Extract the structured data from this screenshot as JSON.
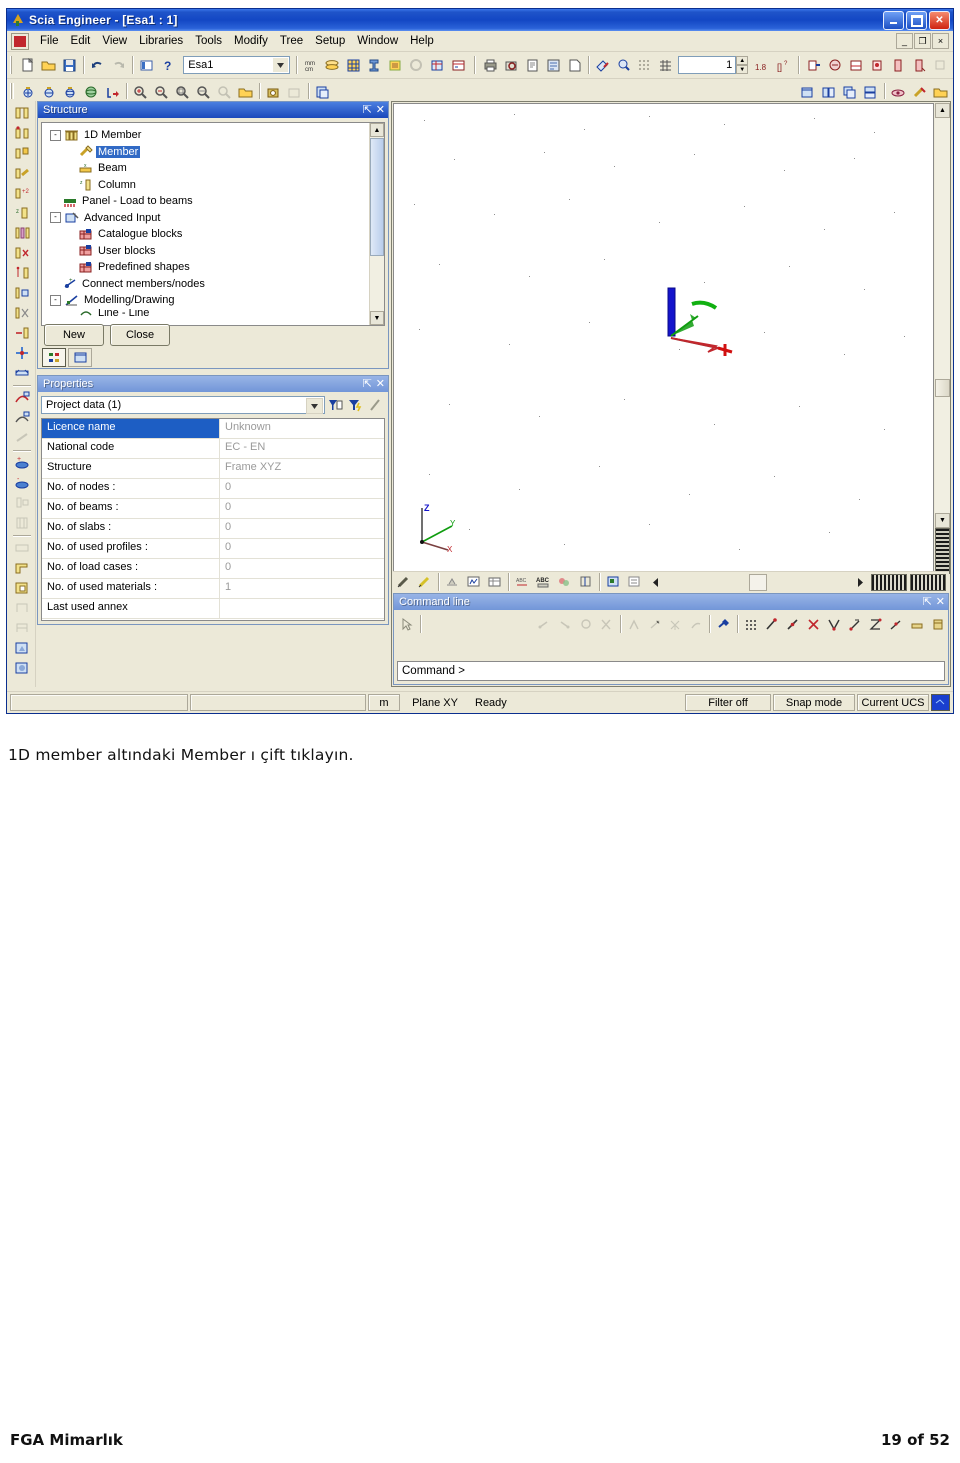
{
  "window": {
    "title": "Scia Engineer - [Esa1 : 1]",
    "app_icon": "scia-logo-icon",
    "buttons": {
      "minimize": "minimize-icon",
      "maximize": "maximize-icon",
      "close": "close-icon"
    },
    "mdi_buttons": {
      "minimize": "_",
      "restore": "❐",
      "close": "×"
    }
  },
  "menubar": {
    "items": [
      {
        "label": "File",
        "accel": "F"
      },
      {
        "label": "Edit",
        "accel": "E"
      },
      {
        "label": "View",
        "accel": "V"
      },
      {
        "label": "Libraries",
        "accel": "L"
      },
      {
        "label": "Tools",
        "accel": "T"
      },
      {
        "label": "Modify",
        "accel": "M"
      },
      {
        "label": "Tree",
        "accel": "r"
      },
      {
        "label": "Setup",
        "accel": "S"
      },
      {
        "label": "Window",
        "accel": "W"
      },
      {
        "label": "Help",
        "accel": "H"
      }
    ]
  },
  "toolbar": {
    "project_combo_value": "Esa1",
    "layer_spin_value": "1",
    "icons_row1_left": [
      "new-document-icon",
      "open-folder-icon",
      "save-disk-icon",
      "undo-icon",
      "redo-icon",
      "project-data-icon",
      "help-question-icon"
    ],
    "icons_row1_mid": [
      "units-mmcm-icon",
      "layers-icon",
      "grid-setup-icon",
      "cross-section-icon",
      "materials-icon",
      "loads-disabled-icon",
      "structure-icon",
      "calculation-icon"
    ],
    "icons_row1_right": [
      "print-icon",
      "print-preview-icon",
      "document-icon",
      "report-icon",
      "page-icon",
      "paint-icon",
      "zoom-selection-icon",
      "dot-grid-icon",
      "line-grid-icon",
      "decimals-icon",
      "units-query-icon",
      "result-1-icon",
      "result-2-icon",
      "result-3-icon",
      "result-4-icon",
      "result-5-icon",
      "result-6-icon",
      "result-7-disabled-icon"
    ],
    "icons_row2_left": [
      "view-front-icon",
      "view-side-icon",
      "view-top-icon",
      "view-3d-icon",
      "render-icon",
      "zoom-in-icon",
      "zoom-out-icon",
      "zoom-window-icon",
      "zoom-all-icon",
      "zoom-prev-disabled-icon",
      "open-view-icon",
      "camera-icon",
      "camera-disabled-icon",
      "copy-view-icon"
    ],
    "icons_row2_right": [
      "window-new-icon",
      "window-tile-icon",
      "window-cascade-icon",
      "window-arrange-icon",
      "eye-visibility-icon",
      "clean-icon",
      "folder-open-icon"
    ]
  },
  "vertical_toolbar": {
    "icons": [
      "member-1-icon",
      "member-2-icon",
      "member-3-icon",
      "member-4-icon",
      "member-5-icon",
      "column-icon",
      "multi-member-icon",
      "cut-member-icon",
      "split-member-icon",
      "align-member-icon",
      "trim-member-icon",
      "extend-member-icon",
      "join-member-icon",
      "mirror-member-icon",
      "arc-node-icon",
      "node-support-icon",
      "hinge-disabled-icon",
      "add-node-icon",
      "remove-node-icon",
      "support-disabled-icon",
      "building-disabled-icon",
      "slab-disabled-icon",
      "plane-icon",
      "plane-opening-icon",
      "wall-disabled-icon",
      "wall2-disabled-icon",
      "surface-load-icon",
      "surface-load-2-icon"
    ]
  },
  "structure_panel": {
    "title": "Structure",
    "pin_icon": "pin-icon",
    "close_icon": "close-icon",
    "tree": [
      {
        "label": "1D Member",
        "level": 0,
        "expander": "-",
        "icon": "1d-member-icon",
        "selected": false
      },
      {
        "label": "Member",
        "level": 1,
        "expander": "",
        "icon": "member-icon",
        "selected": true
      },
      {
        "label": "Beam",
        "level": 1,
        "expander": "",
        "icon": "beam-icon",
        "selected": false
      },
      {
        "label": "Column",
        "level": 1,
        "expander": "",
        "icon": "column-icon",
        "selected": false
      },
      {
        "label": "Panel - Load to beams",
        "level": 0,
        "expander": "",
        "icon": "panel-load-icon",
        "selected": false
      },
      {
        "label": "Advanced Input",
        "level": 0,
        "expander": "-",
        "icon": "advanced-input-icon",
        "selected": false
      },
      {
        "label": "Catalogue blocks",
        "level": 1,
        "expander": "",
        "icon": "catalogue-block-icon",
        "selected": false
      },
      {
        "label": "User blocks",
        "level": 1,
        "expander": "",
        "icon": "user-block-icon",
        "selected": false
      },
      {
        "label": "Predefined shapes",
        "level": 1,
        "expander": "",
        "icon": "predefined-shape-icon",
        "selected": false
      },
      {
        "label": "Connect members/nodes",
        "level": 0,
        "expander": "",
        "icon": "connect-members-icon",
        "selected": false
      },
      {
        "label": "Modelling/Drawing",
        "level": 0,
        "expander": "-",
        "icon": "modelling-drawing-icon",
        "selected": false
      },
      {
        "label": "Line - Line",
        "level": 1,
        "expander": "",
        "icon": "line-line-icon",
        "selected": false
      }
    ],
    "buttons": {
      "new": "New",
      "close": "Close"
    },
    "mini_tabs": [
      "service-tree-icon",
      "window-tab-icon"
    ]
  },
  "properties_panel": {
    "title": "Properties",
    "pin_icon": "pin-icon",
    "close_icon": "close-icon",
    "selector_value": "Project data (1)",
    "action_icons": [
      "filter-table-icon",
      "filter-lightning-icon",
      "edit-pencil-icon"
    ],
    "rows": [
      {
        "name": "Licence name",
        "value": "Unknown",
        "selected": true
      },
      {
        "name": "National code",
        "value": "EC - EN",
        "selected": false
      },
      {
        "name": "Structure",
        "value": "Frame XYZ",
        "selected": false
      },
      {
        "name": "No. of nodes :",
        "value": "0",
        "selected": false
      },
      {
        "name": "No. of beams :",
        "value": "0",
        "selected": false
      },
      {
        "name": "No. of slabs :",
        "value": "0",
        "selected": false
      },
      {
        "name": "No. of used profiles :",
        "value": "0",
        "selected": false
      },
      {
        "name": "No. of load cases :",
        "value": "0",
        "selected": false
      },
      {
        "name": "No. of used materials :",
        "value": "1",
        "selected": false
      },
      {
        "name": "Last used annex",
        "value": "",
        "selected": false
      }
    ]
  },
  "viewport": {
    "axis_triad": {
      "z": "Z",
      "y": "Y",
      "x": "X"
    },
    "cursor_marker": "ucs-cursor-marker",
    "colors": {
      "axis_z": "#0000cc",
      "axis_y": "#00a000",
      "axis_x": "#cc0000",
      "grid_dot": "#8e8e8e"
    },
    "toolbar_icons": [
      "pen-icon",
      "pen-yellow-icon",
      "layer-icon",
      "chart-icon",
      "table-icon",
      "abc-small-icon",
      "abc-icon",
      "colors-icon",
      "align-icon",
      "view-props-icon",
      "view-props2-icon",
      "scroll-left-icon"
    ],
    "scroll_right_icon": "scroll-right-icon"
  },
  "command_panel": {
    "title": "Command line",
    "pin_icon": "pin-icon",
    "close_icon": "close-icon",
    "input_prompt": "Command >",
    "input_value": "",
    "tool_icons": [
      "cursor-arrow-icon",
      "snap-a-disabled-icon",
      "snap-b-disabled-icon",
      "snap-c-disabled-icon",
      "snap-d-disabled-icon",
      "snap-e-disabled-icon",
      "snap-f-disabled-icon",
      "snap-g-disabled-icon",
      "snap-h-disabled-icon",
      "snap-magnet-icon",
      "snap-grid-icon",
      "snap-endpoint-icon",
      "snap-midpoint-icon",
      "snap-intersection-icon",
      "snap-perpendicular-icon",
      "snap-tangent-icon",
      "snap-center-icon",
      "snap-nearest-icon",
      "snap-extension-icon",
      "snap-parallel-icon"
    ]
  },
  "statusbar": {
    "coord_cell_1": "",
    "coord_cell_2": "",
    "units": "m",
    "plane": "Plane XY",
    "state": "Ready",
    "filter": "Filter off",
    "snap": "Snap mode",
    "ucs": "Current UCS",
    "ucs_swatch_color": "#1a3fcf"
  },
  "page": {
    "caption": "1D  member  altındaki  Member  ı  çift tıklayın.",
    "footer_left": "FGA Mimarlık",
    "footer_right": "19 of  52"
  }
}
